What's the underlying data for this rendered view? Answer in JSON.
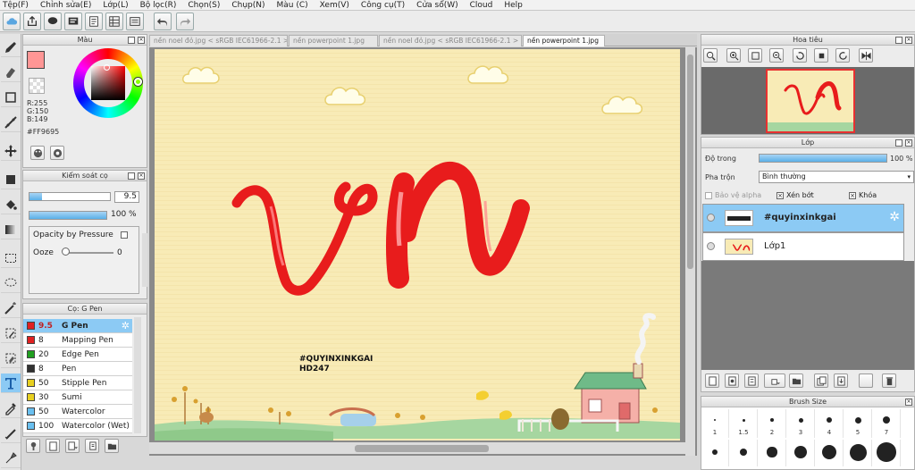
{
  "menu": [
    "Tệp(F)",
    "Chỉnh sửa(E)",
    "Lớp(L)",
    "Bộ lọc(R)",
    "Chọn(S)",
    "Chụp(N)",
    "Màu (C)",
    "Xem(V)",
    "Công cụ(T)",
    "Cửa sổ(W)",
    "Cloud",
    "Help"
  ],
  "panels": {
    "color_title": "Màu",
    "brush_control_title": "Kiểm soát cọ",
    "brush_list_title": "Cọ: G Pen",
    "navigator_title": "Hoa tiêu",
    "layer_title": "Lớp",
    "brush_size_title": "Brush Size"
  },
  "color": {
    "main_hex": "#FF9695",
    "r": "R:255",
    "g": "G:150",
    "b": "B:149",
    "hex_label": "#FF9695"
  },
  "brush_control": {
    "size_value": "9.5",
    "opacity_value": "100 %",
    "opacity_fraction": 1.0,
    "size_fraction": 0.15,
    "opacity_pressure_label": "Opacity by Pressure",
    "ooze_label": "Ooze",
    "ooze_value": "0"
  },
  "brushes": [
    {
      "size": "9.5",
      "name": "G Pen",
      "color": "#e02020",
      "selected": true
    },
    {
      "size": "8",
      "name": "Mapping Pen",
      "color": "#e02020",
      "selected": false
    },
    {
      "size": "20",
      "name": "Edge Pen",
      "color": "#20a020",
      "selected": false
    },
    {
      "size": "8",
      "name": "Pen",
      "color": "#303030",
      "selected": false
    },
    {
      "size": "50",
      "name": "Stipple Pen",
      "color": "#e8d020",
      "selected": false
    },
    {
      "size": "30",
      "name": "Sumi",
      "color": "#e8d020",
      "selected": false
    },
    {
      "size": "50",
      "name": "Watercolor",
      "color": "#6ac0f0",
      "selected": false
    },
    {
      "size": "100",
      "name": "Watercolor (Wet)",
      "color": "#6ac0f0",
      "selected": false
    }
  ],
  "tabs": [
    {
      "label": "nền noel đỏ.jpg < sRGB IEC61966-2.1 >",
      "active": false
    },
    {
      "label": "nền powerpoint 1.jpg",
      "active": false
    },
    {
      "label": "nền noel đỏ.jpg < sRGB IEC61966-2.1 >",
      "active": false
    },
    {
      "label": "nền powerpoint 1.jpg",
      "active": true
    }
  ],
  "canvas": {
    "lettering": "vn",
    "caption_line1": "#QUYINXINKGAI",
    "caption_line2": "HD247",
    "background_color": "#f8ebb6",
    "letter_color": "#e81c1c"
  },
  "layer_panel": {
    "opacity_label": "Độ trong",
    "opacity_value": "100 %",
    "opacity_fraction": 1.0,
    "blend_label": "Pha trộn",
    "blend_value": "Bình thường",
    "protect_alpha": "Bảo vệ alpha",
    "clip": "Xén bớt",
    "lock": "Khóa",
    "layers": [
      {
        "name": "#quyinxinkgai",
        "selected": true
      },
      {
        "name": "Lớp1",
        "selected": false
      }
    ]
  },
  "brush_size_panel": {
    "labels": [
      "1",
      "1.5",
      "2",
      "3",
      "4",
      "5",
      "7"
    ]
  }
}
